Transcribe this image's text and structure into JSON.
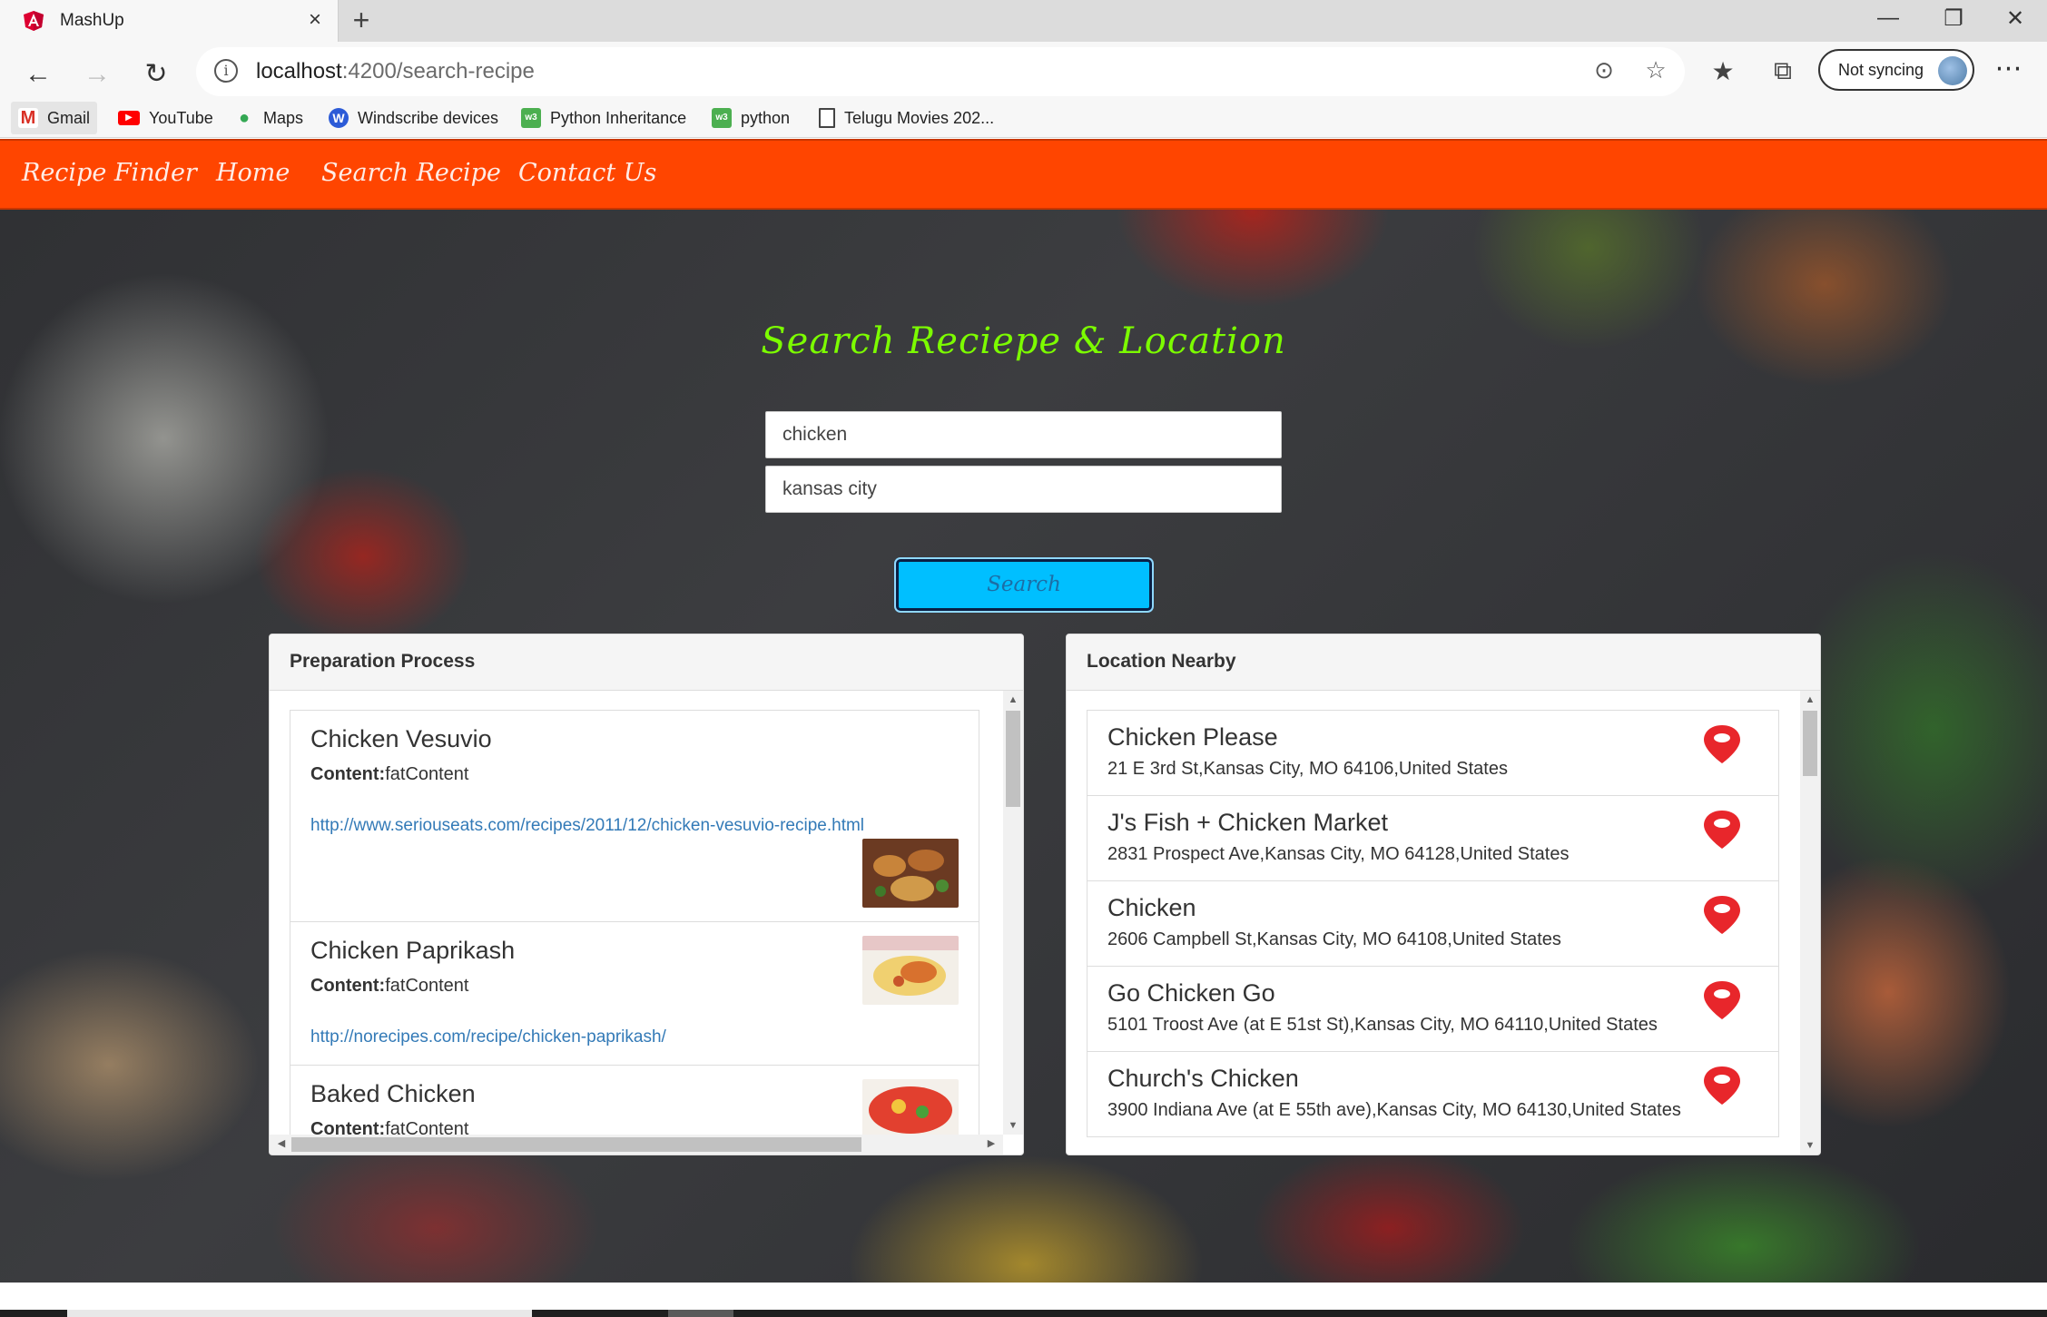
{
  "browser": {
    "tab_title": "MashUp",
    "tab_close": "×",
    "new_tab": "+",
    "url_host": "localhost",
    "url_path": ":4200/search-recipe",
    "sync_label": "Not syncing",
    "window_controls": [
      "—",
      "❐",
      "✕"
    ],
    "bookmarks": [
      {
        "label": "Gmail",
        "icon": "gmail-icon"
      },
      {
        "label": "YouTube",
        "icon": "youtube-icon"
      },
      {
        "label": "Maps",
        "icon": "maps-icon"
      },
      {
        "label": "Windscribe devices",
        "icon": "windscribe-icon"
      },
      {
        "label": "Python Inheritance",
        "icon": "w3schools-icon"
      },
      {
        "label": "python",
        "icon": "w3schools-icon"
      },
      {
        "label": "Telugu Movies 202...",
        "icon": "page-icon"
      }
    ]
  },
  "navbar": {
    "brand": "Recipe Finder",
    "links": [
      "Home",
      "Search Recipe",
      "Contact Us"
    ],
    "color": "#ff4500"
  },
  "search": {
    "title": "Search Reciepe & Location",
    "recipe_value": "chicken",
    "location_value": "kansas city",
    "button_label": "Search",
    "title_color": "#7cfc00",
    "button_color": "#00bfff"
  },
  "recipes_panel": {
    "heading": "Preparation Process",
    "content_label": "Content:",
    "items": [
      {
        "title": "Chicken Vesuvio",
        "content": "fatContent",
        "link": "http://www.seriouseats.com/recipes/2011/12/chicken-vesuvio-recipe.html"
      },
      {
        "title": "Chicken Paprikash",
        "content": "fatContent",
        "link": "http://norecipes.com/recipe/chicken-paprikash/"
      },
      {
        "title": "Baked Chicken",
        "content": "fatContent",
        "link": ""
      }
    ]
  },
  "locations_panel": {
    "heading": "Location Nearby",
    "items": [
      {
        "name": "Chicken Please",
        "address": "21 E 3rd St,Kansas City, MO 64106,United States"
      },
      {
        "name": "J's Fish + Chicken Market",
        "address": "2831 Prospect Ave,Kansas City, MO 64128,United States"
      },
      {
        "name": "Chicken",
        "address": "2606 Campbell St,Kansas City, MO 64108,United States"
      },
      {
        "name": "Go Chicken Go",
        "address": "5101 Troost Ave (at E 51st St),Kansas City, MO 64110,United States"
      },
      {
        "name": "Church's Chicken",
        "address": "3900 Indiana Ave (at E 55th ave),Kansas City, MO 64130,United States"
      }
    ],
    "pin_color": "#e8262b"
  }
}
